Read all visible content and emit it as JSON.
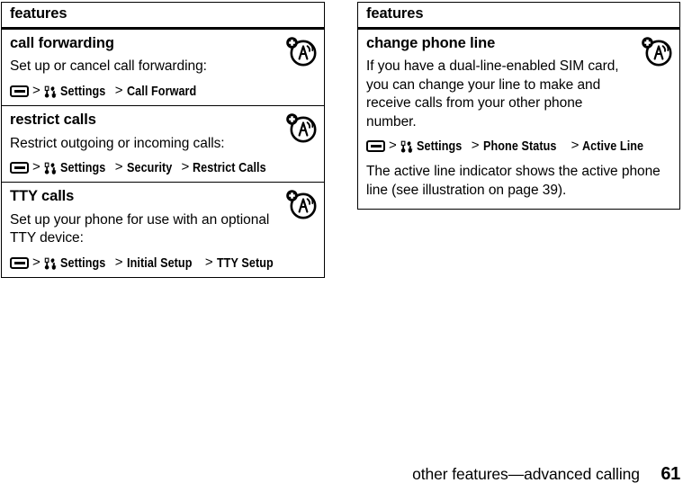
{
  "left_table": {
    "header": "features",
    "rows": [
      {
        "title": "call forwarding",
        "body": "Set up or cancel call forwarding:",
        "icon": "network-antenna-badge-icon",
        "path": [
          "Settings",
          "Call Forward"
        ],
        "path_icons": [
          "menu-key-icon",
          "settings-tools-icon"
        ],
        "separator": ">"
      },
      {
        "title": "restrict calls",
        "body": "Restrict outgoing or incoming calls:",
        "icon": "network-antenna-badge-icon",
        "path": [
          "Settings",
          "Security",
          "Restrict Calls"
        ],
        "path_icons": [
          "menu-key-icon",
          "settings-tools-icon"
        ],
        "separator": ">"
      },
      {
        "title": "TTY calls",
        "body": "Set up your phone for use with an optional TTY device:",
        "icon": "network-antenna-badge-icon",
        "path": [
          "Settings",
          "Initial Setup",
          "TTY Setup"
        ],
        "path_icons": [
          "menu-key-icon",
          "settings-tools-icon"
        ],
        "separator": ">"
      }
    ]
  },
  "right_table": {
    "header": "features",
    "rows": [
      {
        "title": "change phone line",
        "body": "If you have a dual-line-enabled SIM card, you can change your line to make and receive calls from your other phone number.",
        "body2": "The active line indicator shows the active phone line (see illustration on page 39).",
        "icon": "network-antenna-badge-icon",
        "path": [
          "Settings",
          "Phone Status",
          "Active Line"
        ],
        "path_icons": [
          "menu-key-icon",
          "settings-tools-icon"
        ],
        "separator": ">"
      }
    ]
  },
  "footer": {
    "text": "other features—advanced calling",
    "page_number": "61"
  },
  "colors": {
    "ink": "#000000",
    "paper": "#ffffff"
  }
}
